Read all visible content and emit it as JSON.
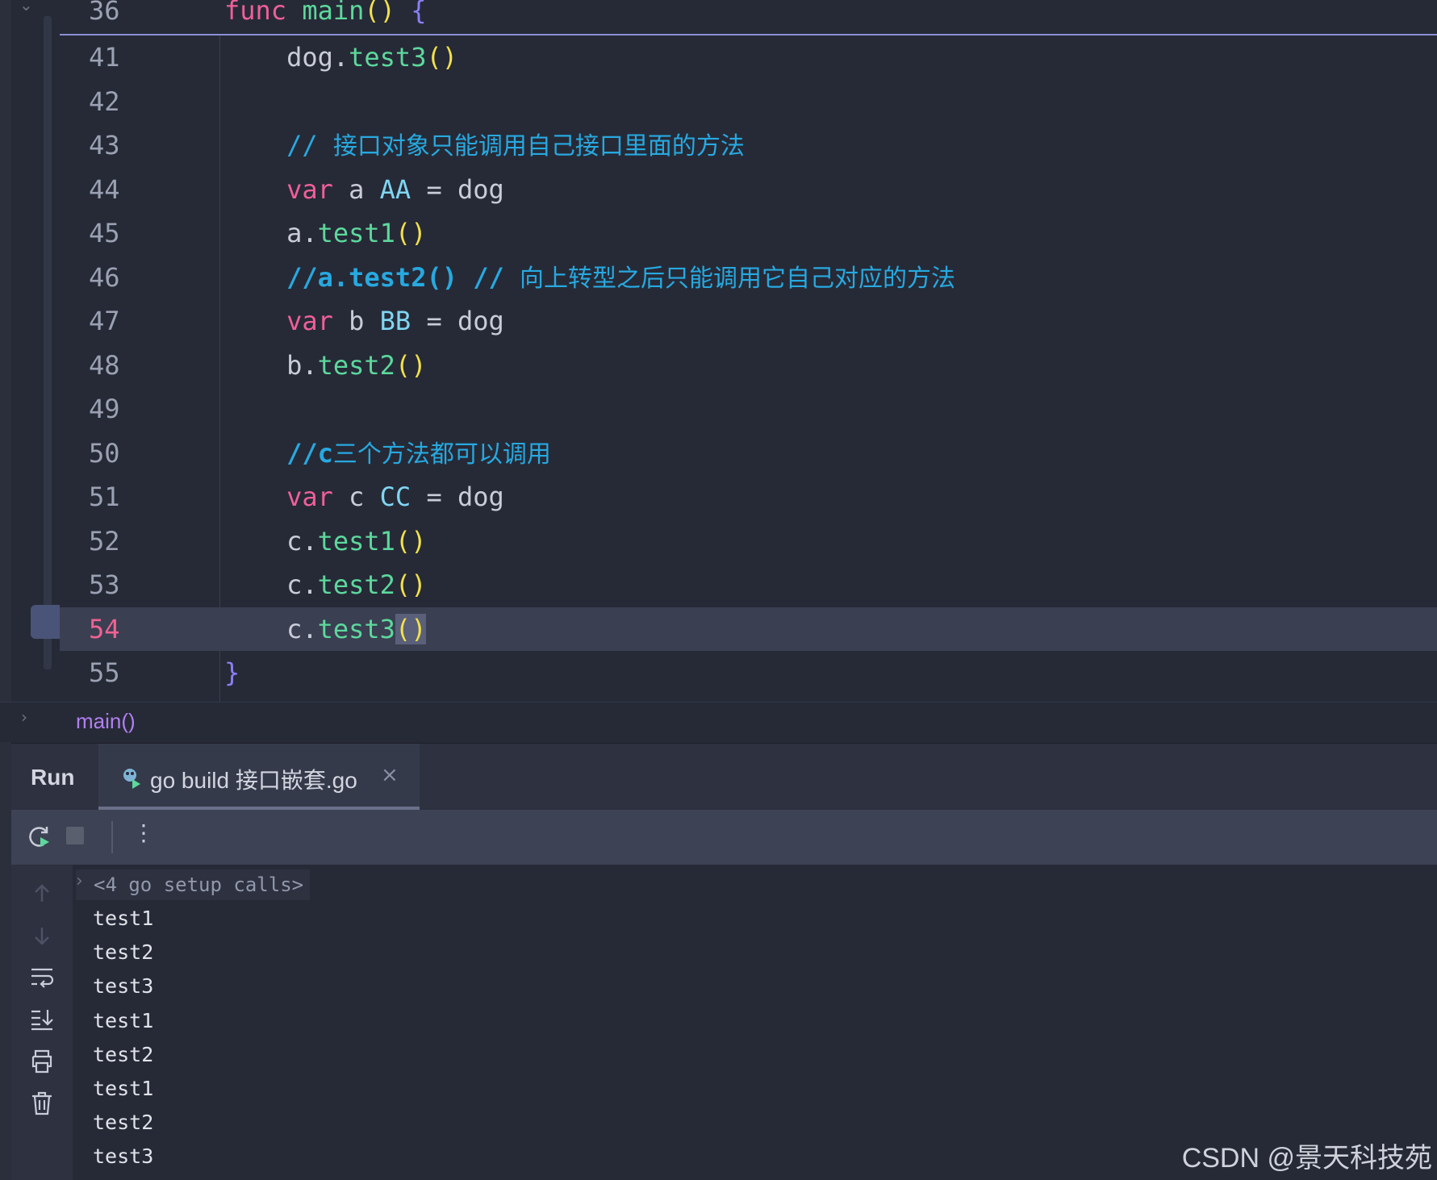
{
  "editor": {
    "sticky_line": {
      "number": "36",
      "tokens": [
        {
          "t": "func",
          "c": "kw"
        },
        {
          "t": " ",
          "c": ""
        },
        {
          "t": "main",
          "c": "fn"
        },
        {
          "t": "()",
          "c": "paren"
        },
        {
          "t": " ",
          "c": ""
        },
        {
          "t": "{",
          "c": "brace"
        }
      ]
    },
    "lines": [
      {
        "number": "41",
        "tokens": [
          {
            "t": "    dog.",
            "c": ""
          },
          {
            "t": "test3",
            "c": "fn"
          },
          {
            "t": "()",
            "c": "paren"
          }
        ]
      },
      {
        "number": "42",
        "tokens": []
      },
      {
        "number": "43",
        "tokens": [
          {
            "t": "    // ",
            "c": "cmt"
          },
          {
            "t": "接口对象只能调用自己接口里面的方法",
            "c": "cmt cjk"
          }
        ]
      },
      {
        "number": "44",
        "tokens": [
          {
            "t": "    ",
            "c": ""
          },
          {
            "t": "var",
            "c": "kw"
          },
          {
            "t": " a ",
            "c": ""
          },
          {
            "t": "AA",
            "c": "type"
          },
          {
            "t": " = dog",
            "c": ""
          }
        ]
      },
      {
        "number": "45",
        "tokens": [
          {
            "t": "    a.",
            "c": ""
          },
          {
            "t": "test1",
            "c": "fn"
          },
          {
            "t": "()",
            "c": "paren"
          }
        ]
      },
      {
        "number": "46",
        "tokens": [
          {
            "t": "    //a.test2() // ",
            "c": "cmt-b"
          },
          {
            "t": "向上转型之后只能调用它自己对应的方法",
            "c": "cmt cjk"
          }
        ]
      },
      {
        "number": "47",
        "tokens": [
          {
            "t": "    ",
            "c": ""
          },
          {
            "t": "var",
            "c": "kw"
          },
          {
            "t": " b ",
            "c": ""
          },
          {
            "t": "BB",
            "c": "type"
          },
          {
            "t": " = dog",
            "c": ""
          }
        ]
      },
      {
        "number": "48",
        "tokens": [
          {
            "t": "    b.",
            "c": ""
          },
          {
            "t": "test2",
            "c": "fn"
          },
          {
            "t": "()",
            "c": "paren"
          }
        ]
      },
      {
        "number": "49",
        "tokens": []
      },
      {
        "number": "50",
        "tokens": [
          {
            "t": "    //c",
            "c": "cmt-b"
          },
          {
            "t": "三个方法都可以调用",
            "c": "cmt cjk"
          }
        ]
      },
      {
        "number": "51",
        "tokens": [
          {
            "t": "    ",
            "c": ""
          },
          {
            "t": "var",
            "c": "kw"
          },
          {
            "t": " c ",
            "c": ""
          },
          {
            "t": "CC",
            "c": "type"
          },
          {
            "t": " = dog",
            "c": ""
          }
        ]
      },
      {
        "number": "52",
        "tokens": [
          {
            "t": "    c.",
            "c": ""
          },
          {
            "t": "test1",
            "c": "fn"
          },
          {
            "t": "()",
            "c": "paren"
          }
        ]
      },
      {
        "number": "53",
        "tokens": [
          {
            "t": "    c.",
            "c": ""
          },
          {
            "t": "test2",
            "c": "fn"
          },
          {
            "t": "()",
            "c": "paren"
          }
        ]
      },
      {
        "number": "54",
        "current": true,
        "tokens": [
          {
            "t": "    c.",
            "c": ""
          },
          {
            "t": "test3",
            "c": "fn"
          },
          {
            "t": "()",
            "c": "paren caret-hl"
          }
        ]
      },
      {
        "number": "55",
        "tokens": [
          {
            "t": "}",
            "c": "brace"
          }
        ]
      }
    ]
  },
  "breadcrumb": {
    "text": "main()"
  },
  "run_panel": {
    "title": "Run",
    "tab_label": "go build 接口嵌套.go",
    "close_glyph": "×",
    "more_glyph": "⋮",
    "setup_calls": "<4 go setup calls>",
    "output": [
      "test1",
      "test2",
      "test3",
      "test1",
      "test2",
      "test1",
      "test2",
      "test3"
    ]
  },
  "watermark": "CSDN @景天科技苑",
  "colors": {
    "background": "#262a37",
    "keyword": "#ef5f98",
    "function": "#5dd89c",
    "paren": "#f3e14a",
    "comment": "#27a9e0",
    "type": "#7fd6f2",
    "current_line_number": "#f06292"
  },
  "icons": [
    "chevron-down-icon",
    "chevron-right-icon",
    "rerun-icon",
    "stop-icon",
    "more-icon",
    "go-file-icon",
    "close-icon",
    "arrow-up-icon",
    "arrow-down-icon",
    "soft-wrap-icon",
    "scroll-to-end-icon",
    "print-icon",
    "trash-icon"
  ]
}
